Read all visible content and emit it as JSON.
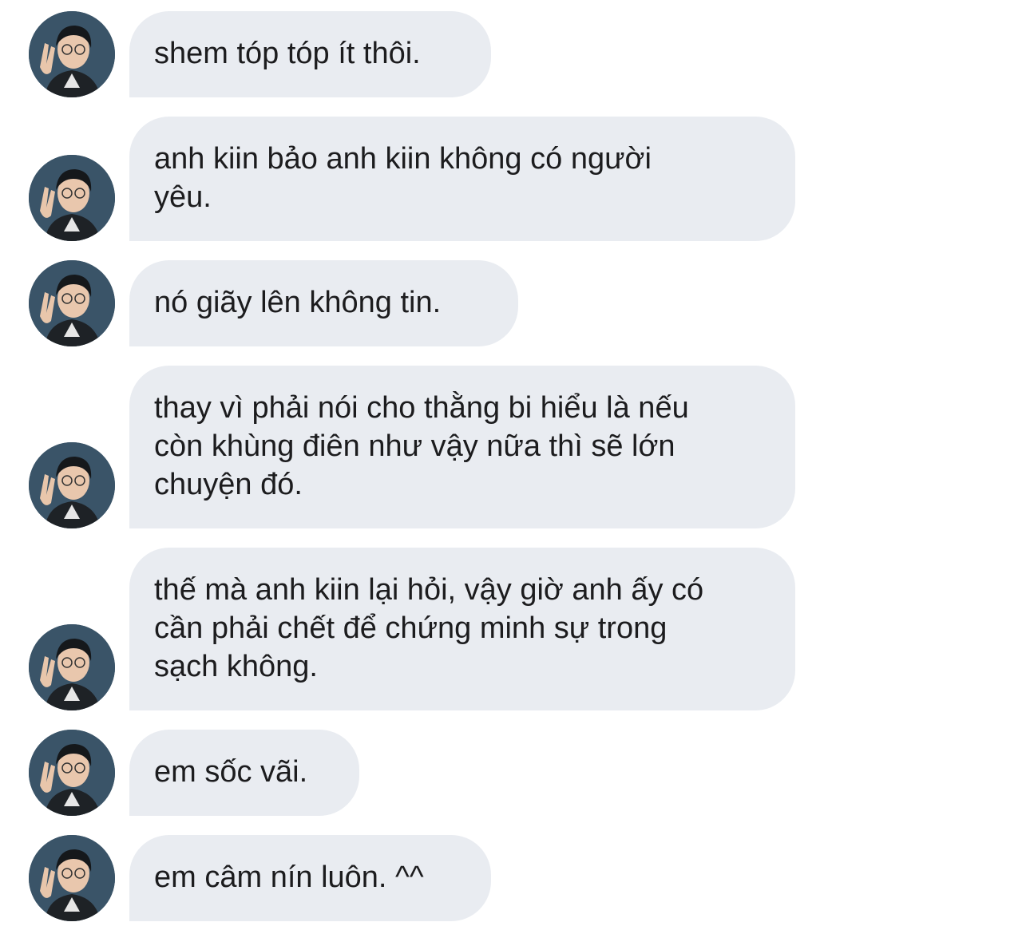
{
  "colors": {
    "bubble": "#e9ecf1",
    "text": "#1c1c1e",
    "background": "#ffffff"
  },
  "sender": {
    "avatar_icon": "profile-photo-peace-sign"
  },
  "messages": [
    {
      "text": "shem tóp tóp ít thôi."
    },
    {
      "text": "anh kiin bảo anh kiin không có người\nyêu."
    },
    {
      "text": "nó giãy lên không tin."
    },
    {
      "text": "thay vì phải nói cho thằng bi hiểu là nếu\ncòn khùng điên như vậy nữa thì sẽ lớn\nchuyện đó."
    },
    {
      "text": "thế mà anh kiin lại hỏi, vậy giờ anh ấy có\ncần phải chết để chứng minh sự trong\nsạch không."
    },
    {
      "text": "em sốc vãi."
    },
    {
      "text": "em câm nín luôn. ^^"
    }
  ]
}
